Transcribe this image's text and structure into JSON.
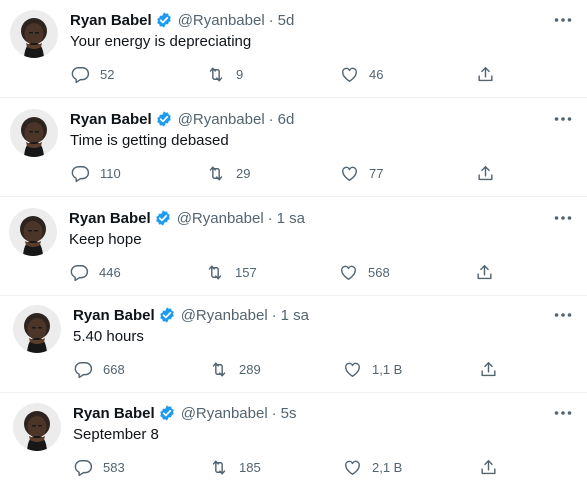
{
  "tweets": [
    {
      "name": "Ryan Babel",
      "handle": "@Ryanbabel",
      "separator": "·",
      "time": "5d",
      "text": "Your energy is depreciating",
      "reply_count": "52",
      "retweet_count": "9",
      "like_count": "46"
    },
    {
      "name": "Ryan Babel",
      "handle": "@Ryanbabel",
      "separator": "·",
      "time": "6d",
      "text": "Time is getting debased",
      "reply_count": "110",
      "retweet_count": "29",
      "like_count": "77"
    },
    {
      "name": "Ryan Babel",
      "handle": "@Ryanbabel",
      "separator": "·",
      "time": "1 sa",
      "text": "Keep hope",
      "reply_count": "446",
      "retweet_count": "157",
      "like_count": "568"
    },
    {
      "name": "Ryan Babel",
      "handle": "@Ryanbabel",
      "separator": "·",
      "time": "1 sa",
      "text": "5.40 hours",
      "reply_count": "668",
      "retweet_count": "289",
      "like_count": "1,1 B"
    },
    {
      "name": "Ryan Babel",
      "handle": "@Ryanbabel",
      "separator": "·",
      "time": "5s",
      "text": "September 8",
      "reply_count": "583",
      "retweet_count": "185",
      "like_count": "2,1 B"
    }
  ],
  "icons": {
    "verified": "verified-badge-icon",
    "more": "more-icon",
    "reply": "reply-icon",
    "retweet": "retweet-icon",
    "like": "like-icon",
    "share": "share-icon"
  },
  "colors": {
    "verified": "#1d9bf0",
    "text": "#0f1419",
    "secondary": "#536471",
    "divider": "#eff3f4"
  }
}
